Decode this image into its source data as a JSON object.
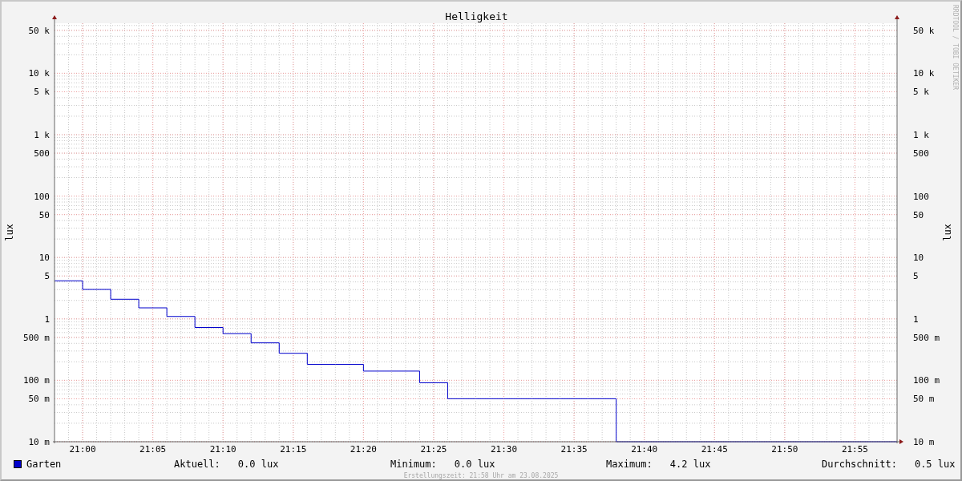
{
  "graph": {
    "title": "Helligkeit",
    "watermark": "RRDTOOL / TOBI OETIKER",
    "left_axis": {
      "label": "lux",
      "ticks": [
        "50 k",
        "10 k",
        "5 k",
        "1 k",
        "500",
        "100",
        "50",
        "10",
        "5",
        "1",
        "500 m",
        "100 m",
        "50 m",
        "10 m"
      ]
    },
    "right_axis": {
      "label": "lux",
      "ticks": [
        "50 k",
        "10 k",
        "5 k",
        "1 k",
        "500",
        "100",
        "50",
        "10",
        "5",
        "1",
        "500 m",
        "100 m",
        "50 m",
        "10 m"
      ]
    },
    "time_axis": {
      "ticks": [
        "21:00",
        "21:05",
        "21:10",
        "21:15",
        "21:20",
        "21:25",
        "21:30",
        "21:35",
        "21:40",
        "21:45",
        "21:50",
        "21:55"
      ]
    }
  },
  "legend": {
    "name": "Garten",
    "stats": [
      {
        "label": "Aktuell:",
        "value": "0.0 lux"
      },
      {
        "label": "Minimum:",
        "value": "0.0 lux"
      },
      {
        "label": "Maximum:",
        "value": "4.2 lux"
      },
      {
        "label": "Durchschnitt:",
        "value": "0.5 lux"
      }
    ]
  },
  "footer": "Erstellungszeit: 21:58 Uhr am 23.08.2025"
}
